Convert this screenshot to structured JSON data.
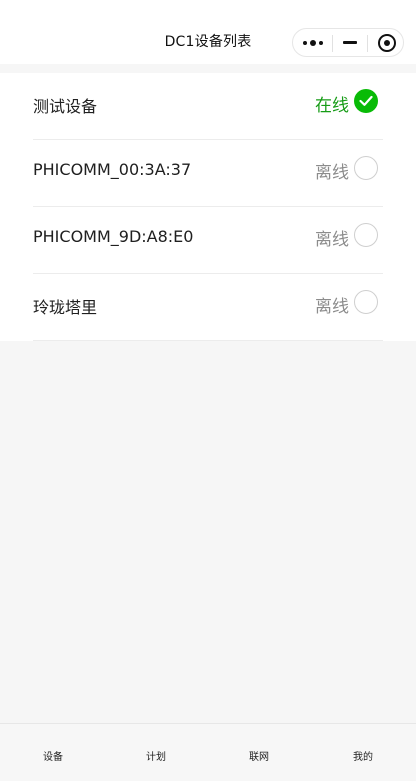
{
  "nav": {
    "title": "DC1设备列表"
  },
  "capsule": {
    "icons": [
      "more-dots-icon",
      "minimize-icon",
      "close-target-icon"
    ]
  },
  "devices": [
    {
      "name": "测试设备",
      "status": "在线",
      "checked": true
    },
    {
      "name": "PHICOMM_00:3A:37",
      "status": "离线",
      "checked": false
    },
    {
      "name": "PHICOMM_9D:A8:E0",
      "status": "离线",
      "checked": false
    },
    {
      "name": "玲珑塔里",
      "status": "离线",
      "checked": false
    }
  ],
  "tabs": [
    {
      "label": "设备"
    },
    {
      "label": "计划"
    },
    {
      "label": "联网"
    },
    {
      "label": "我的"
    }
  ],
  "colors": {
    "online": "#169c16",
    "offline": "#8c8c8c",
    "checked": "#09bb07"
  }
}
